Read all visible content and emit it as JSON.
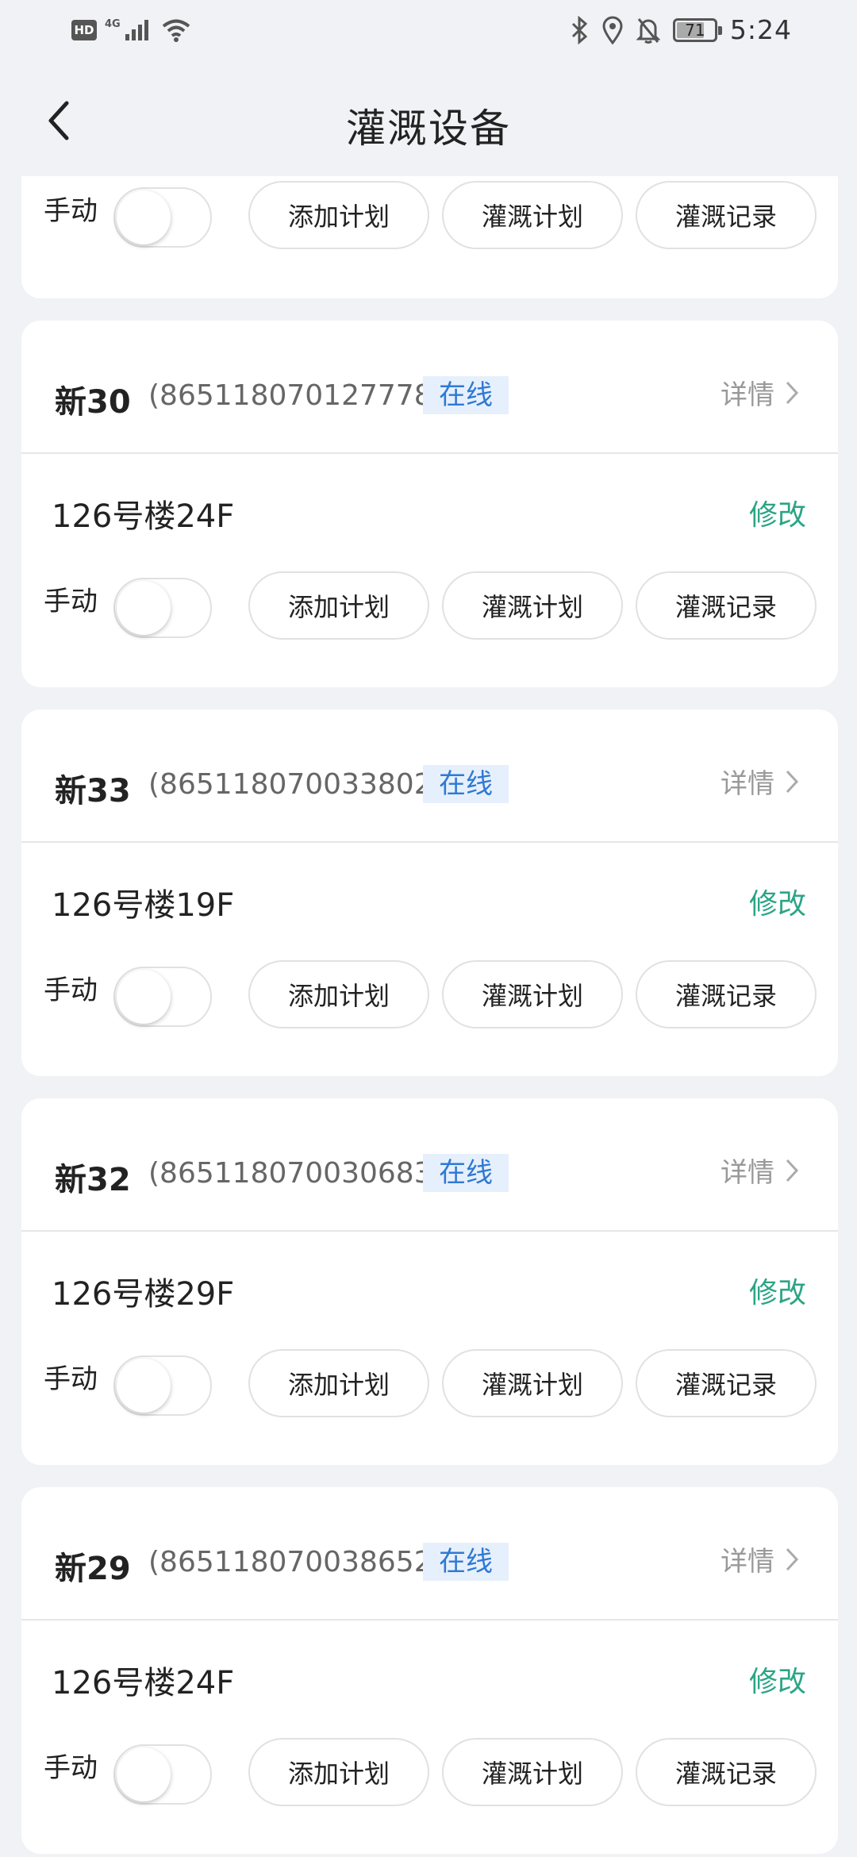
{
  "status_bar": {
    "hd": "HD",
    "network": "4G",
    "battery": "71",
    "battery_level": 71,
    "time": "5:24",
    "icons": [
      "signal-icon",
      "wifi-icon",
      "bluetooth-icon",
      "location-icon",
      "bell-off-icon",
      "battery-icon"
    ]
  },
  "header": {
    "title": "灌溉设备"
  },
  "labels": {
    "manual": "手动",
    "add_plan": "添加计划",
    "irrigation_plan": "灌溉计划",
    "irrigation_record": "灌溉记录",
    "details": "详情",
    "edit": "修改"
  },
  "devices": [
    {
      "name": "新30",
      "id": "(865118070127778)",
      "status": "在线",
      "location": "126号楼24F"
    },
    {
      "name": "新33",
      "id": "(865118070033802)",
      "status": "在线",
      "location": "126号楼19F"
    },
    {
      "name": "新32",
      "id": "(865118070030683)",
      "status": "在线",
      "location": "126号楼29F"
    },
    {
      "name": "新29",
      "id": "(865118070038652)",
      "status": "在线",
      "location": "126号楼24F"
    }
  ],
  "colors": {
    "accent_green": "#2aa585",
    "online_blue": "#2f79d4",
    "online_bg": "#e6f0fc",
    "page_bg": "#f1f2f6"
  }
}
